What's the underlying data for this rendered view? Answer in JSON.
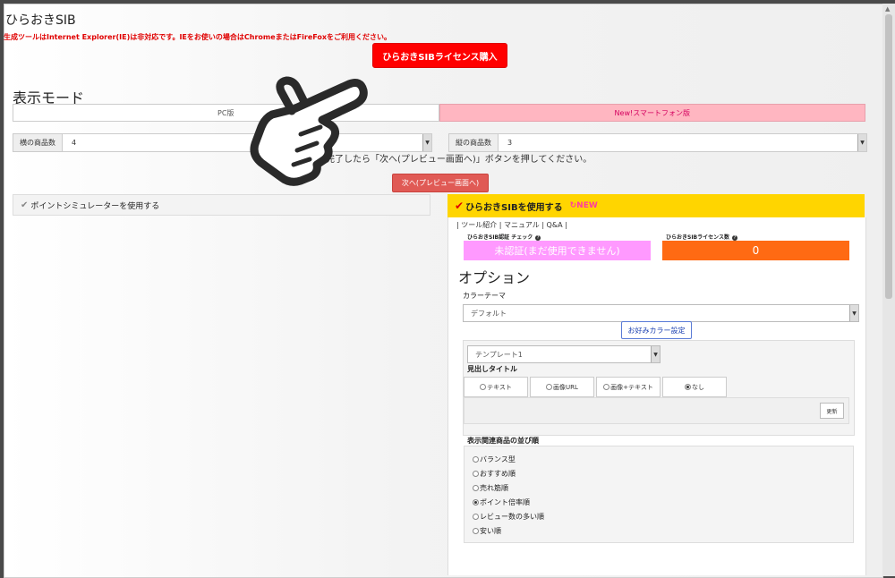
{
  "app": {
    "title": "ひらおきSIB"
  },
  "notice": "生成ツールはInternet Explorer(IE)は非対応です。IEをお使いの場合はChromeまたはFireFoxをご利用ください。",
  "buy_button": "ひらおきSIBライセンス購入",
  "display_mode": {
    "heading": "表示モード",
    "tabs": [
      {
        "label": "PC版",
        "active": false
      },
      {
        "label": "New!スマートフォン版",
        "active": true
      }
    ]
  },
  "columns_select": {
    "label": "横の商品数",
    "value": "4"
  },
  "rows_select": {
    "label": "縦の商品数",
    "value": "3"
  },
  "instruction": "完了したら「次へ(プレビュー画面へ)」ボタンを押してください。",
  "next_button": "次へ(プレビュー画面へ)",
  "point_sim": {
    "label": "ポイントシミュレーターを使用する"
  },
  "sib_panel": {
    "header": "ひらおきSIBを使用する",
    "new_badge": "NEW",
    "links": "| ツール紹介 | マニュアル | Q&A |",
    "auth_label": "ひらおきSIB認証 チェック",
    "auth_status": "未認証(まだ使用できません)",
    "license_label": "ひらおきSIBライセンス数",
    "license_count": "0"
  },
  "options": {
    "heading": "オプション",
    "color_theme_label": "カラーテーマ",
    "color_theme_value": "デフォルト",
    "fav_color_button": "お好みカラー設定",
    "template_value": "テンプレート1",
    "heading_title_label": "見出しタイトル",
    "heading_title_options": [
      {
        "label": "テキスト",
        "selected": false
      },
      {
        "label": "画像URL",
        "selected": false
      },
      {
        "label": "画像+テキスト",
        "selected": false
      },
      {
        "label": "なし",
        "selected": true
      }
    ],
    "update_button": "更新",
    "order_label": "表示関連商品の並び順",
    "order_options": [
      {
        "label": "バランス型",
        "selected": false
      },
      {
        "label": "おすすめ順",
        "selected": false
      },
      {
        "label": "売れ筋順",
        "selected": false
      },
      {
        "label": "ポイント倍率順",
        "selected": true
      },
      {
        "label": "レビュー数の多い順",
        "selected": false
      },
      {
        "label": "安い順",
        "selected": false
      }
    ]
  },
  "colors": {
    "accent_red": "#ff0000",
    "active_tab_pink": "#ffb6c1",
    "sib_yellow": "#ffd500",
    "auth_pink": "#ff99ff",
    "license_orange": "#ff6a13"
  }
}
